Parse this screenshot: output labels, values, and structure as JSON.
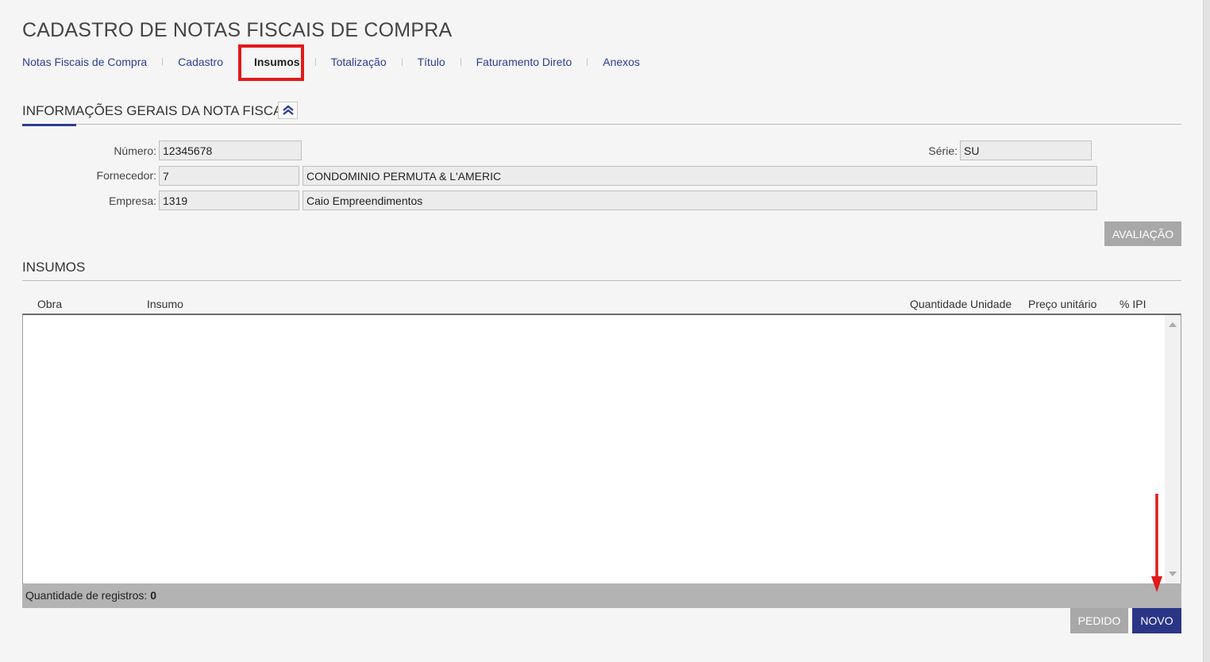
{
  "page": {
    "title": "CADASTRO DE NOTAS FISCAIS DE COMPRA"
  },
  "tabs": [
    {
      "label": "Notas Fiscais de Compra",
      "active": false
    },
    {
      "label": "Cadastro",
      "active": false
    },
    {
      "label": "Insumos",
      "active": true
    },
    {
      "label": "Totalização",
      "active": false
    },
    {
      "label": "Título",
      "active": false
    },
    {
      "label": "Faturamento Direto",
      "active": false
    },
    {
      "label": "Anexos",
      "active": false
    }
  ],
  "general_info": {
    "title": "INFORMAÇÕES GERAIS DA NOTA FISCAL",
    "collapse_icon": "double-chevron-up-icon",
    "numero": {
      "label": "Número:",
      "value": "12345678"
    },
    "serie": {
      "label": "Série:",
      "value": "SU"
    },
    "fornecedor": {
      "label": "Fornecedor:",
      "code": "7",
      "name": "CONDOMINIO PERMUTA &  L'AMERIC"
    },
    "empresa": {
      "label": "Empresa:",
      "code": "1319",
      "name": "Caio Empreendimentos"
    },
    "avaliacao_button": "AVALIAÇÃO"
  },
  "insumos": {
    "title": "INSUMOS",
    "columns": [
      "Obra",
      "Insumo",
      "Quantidade",
      "Unidade",
      "Preço unitário",
      "% IPI"
    ],
    "rows": [],
    "footer_label": "Quantidade de registros:",
    "record_count": "0",
    "pedido_button": "PEDIDO",
    "novo_button": "NOVO"
  },
  "colors": {
    "accent": "#2c3e8f",
    "primary_button": "#2b3585",
    "disabled_button": "#a8a8a8",
    "annotation": "#e21a1a"
  }
}
